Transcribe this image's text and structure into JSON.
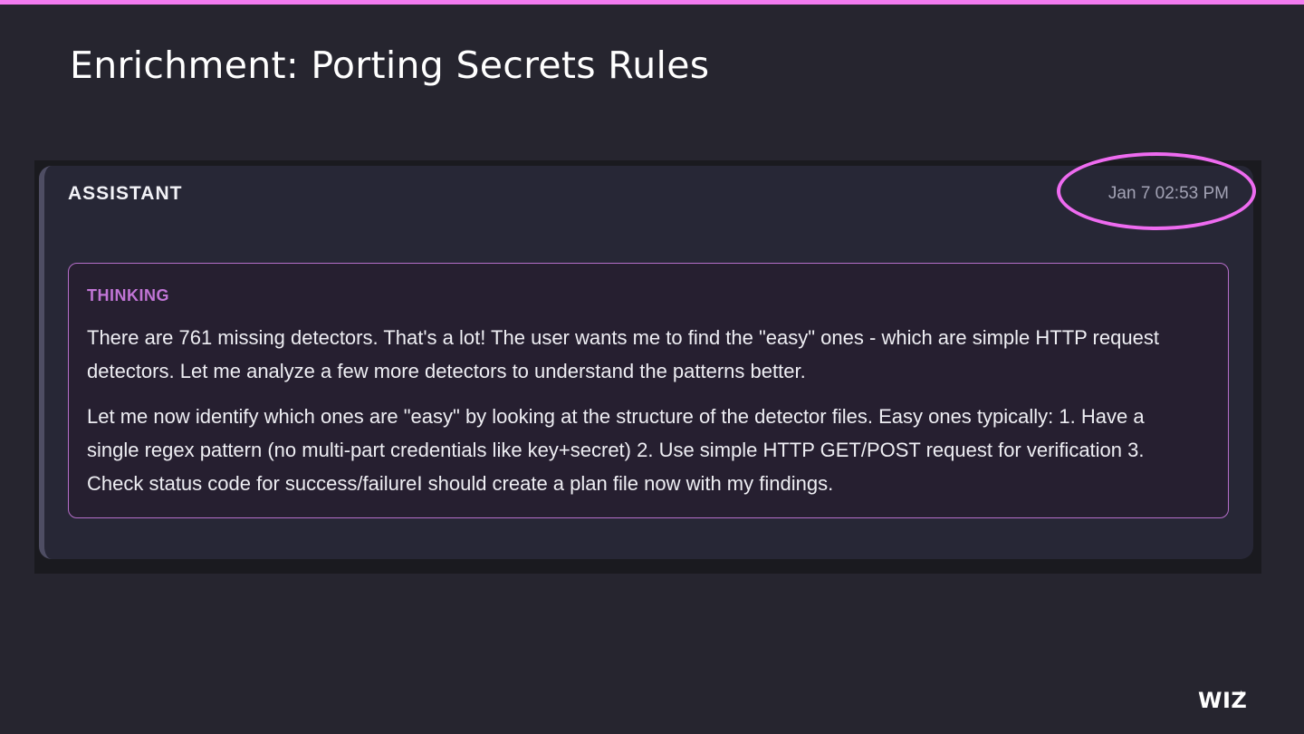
{
  "slide": {
    "title": "Enrichment: Porting Secrets Rules",
    "accent_color": "#f27bf0",
    "brand": "WIZ"
  },
  "message": {
    "role": "ASSISTANT",
    "timestamp": "Jan 7 02:53 PM",
    "timestamp_highlighted": true,
    "thinking": {
      "label": "THINKING",
      "paragraphs": [
        "There are 761 missing detectors. That's a lot! The user wants me to find the \"easy\" ones - which are simple HTTP request detectors. Let me analyze a few more detectors to understand the patterns better.",
        "Let me now identify which ones are \"easy\" by looking at the structure of the detector files. Easy ones typically: 1. Have a single regex pattern (no multi-part credentials like key+secret) 2. Use simple HTTP GET/POST request for verification 3. Check status code for success/failureI should create a plan file now with my findings."
      ]
    }
  }
}
